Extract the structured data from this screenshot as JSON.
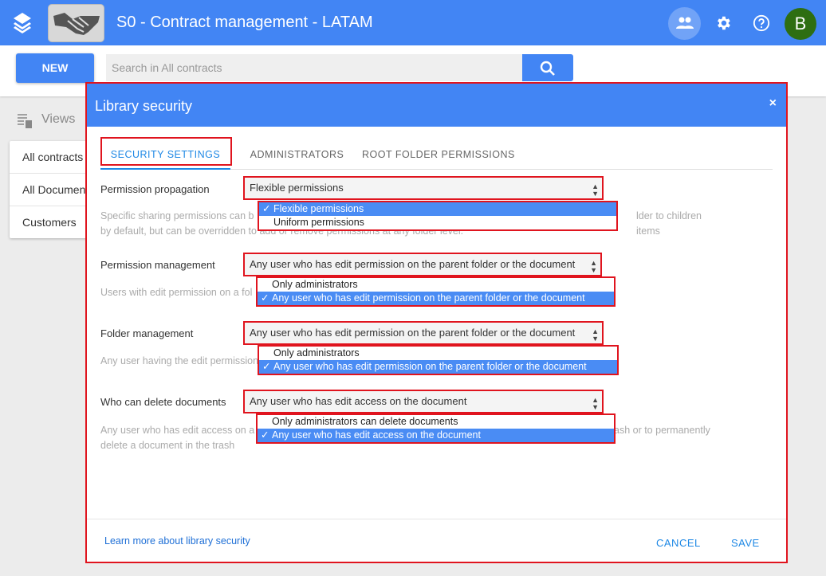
{
  "app": {
    "title": "S0 - Contract management - LATAM",
    "avatar_initial": "B",
    "accent_color": "#4285f4"
  },
  "toolbar": {
    "new_label": "NEW",
    "search_placeholder": "Search in All contracts"
  },
  "sidebar": {
    "views_label": "Views",
    "items": [
      {
        "label": "All contracts"
      },
      {
        "label": "All Documents"
      },
      {
        "label": "Customers"
      }
    ]
  },
  "dialog": {
    "title": "Library security",
    "close_label": "×",
    "tabs": [
      {
        "label": "SECURITY SETTINGS",
        "active": true
      },
      {
        "label": "ADMINISTRATORS",
        "active": false
      },
      {
        "label": "ROOT FOLDER PERMISSIONS",
        "active": false
      }
    ],
    "fields": [
      {
        "label": "Permission propagation",
        "value": "Flexible permissions",
        "desc_visible_left": "Specific sharing permissions can b",
        "desc_visible_right": "lder to children items",
        "desc_line2": "by default, but can be overridden to add or remove permissions at any folder level.",
        "options": [
          {
            "label": "Flexible permissions",
            "selected": true
          },
          {
            "label": "Uniform permissions",
            "selected": false
          }
        ]
      },
      {
        "label": "Permission management",
        "value": "Any user who has edit permission on the parent folder or the document",
        "desc_visible_left": "Users with edit permission on a fol",
        "options": [
          {
            "label": "Only administrators",
            "selected": false
          },
          {
            "label": "Any user who has edit permission on the parent folder or the document",
            "selected": true
          }
        ]
      },
      {
        "label": "Folder management",
        "value": "Any user who has edit permission on the parent folder or the document",
        "desc_visible_left": "Any user having the edit permission",
        "options": [
          {
            "label": "Only administrators",
            "selected": false
          },
          {
            "label": "Any user who has edit permission on the parent folder or the document",
            "selected": true
          }
        ]
      },
      {
        "label": "Who can delete documents",
        "value": "Any user who has edit access on the document",
        "desc_visible_left": "Any user who has edit access on a",
        "desc_visible_right": "ash or to permanently",
        "desc_line2": "delete a document in the trash",
        "options": [
          {
            "label": "Only administrators can delete documents",
            "selected": false
          },
          {
            "label": "Any user who has edit access on the document",
            "selected": true
          }
        ]
      }
    ],
    "footer": {
      "learn_link": "Learn more about library security",
      "cancel_label": "CANCEL",
      "save_label": "SAVE"
    }
  }
}
